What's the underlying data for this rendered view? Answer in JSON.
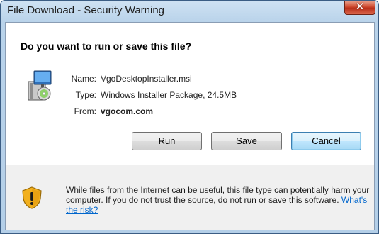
{
  "window": {
    "title": "File Download - Security Warning",
    "close_glyph": "✕"
  },
  "dialog": {
    "heading": "Do you want to run or save this file?",
    "file_icon": "installer-package-icon",
    "fields": {
      "name_label": "Name:",
      "name_value": "VgoDesktopInstaller.msi",
      "type_label": "Type:",
      "type_value": "Windows Installer Package, 24.5MB",
      "from_label": "From:",
      "from_value": "vgocom.com"
    },
    "buttons": {
      "run_pre": "",
      "run_key": "R",
      "run_post": "un",
      "save_pre": "",
      "save_key": "S",
      "save_post": "ave",
      "cancel": "Cancel"
    },
    "warning": {
      "icon": "shield-warning-icon",
      "text": "While files from the Internet can be useful, this file type can potentially harm your computer. If you do not trust the source, do not run or save this software.",
      "link": "What's the risk?"
    }
  },
  "colors": {
    "title_bar": "#b9d3ea",
    "close_button": "#cf4a30",
    "link": "#0066cc",
    "default_button_border": "#3c7fb1"
  }
}
